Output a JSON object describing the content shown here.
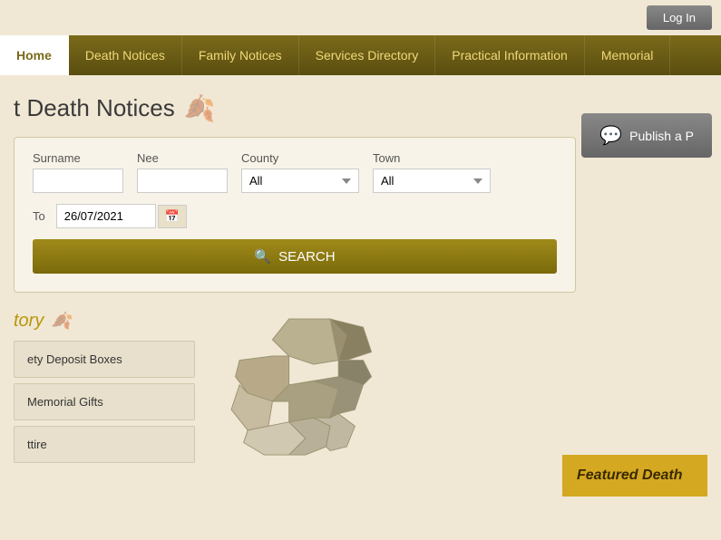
{
  "topBar": {
    "logIn": "Log In"
  },
  "nav": {
    "items": [
      {
        "label": "Home",
        "active": true
      },
      {
        "label": "Death Notices",
        "active": false
      },
      {
        "label": "Family Notices",
        "active": false
      },
      {
        "label": "Services Directory",
        "active": false
      },
      {
        "label": "Practical Information",
        "active": false
      },
      {
        "label": "Memorial",
        "active": false
      }
    ]
  },
  "publishBtn": "Publish a P",
  "searchSection": {
    "title": "t Death Notices",
    "form": {
      "surnameLabel": "Surname",
      "neeLabel": "Nee",
      "countyLabel": "County",
      "countyDefault": "All",
      "townLabel": "Town",
      "townDefault": "All",
      "dateToLabel": "To",
      "dateToValue": "26/07/2021",
      "searchLabel": "SEARCH"
    }
  },
  "directorySection": {
    "title": "tory",
    "items": [
      "ety Deposit Boxes",
      "Memorial Gifts",
      "ttire"
    ]
  },
  "featuredDeath": {
    "label": "Featured Death"
  }
}
